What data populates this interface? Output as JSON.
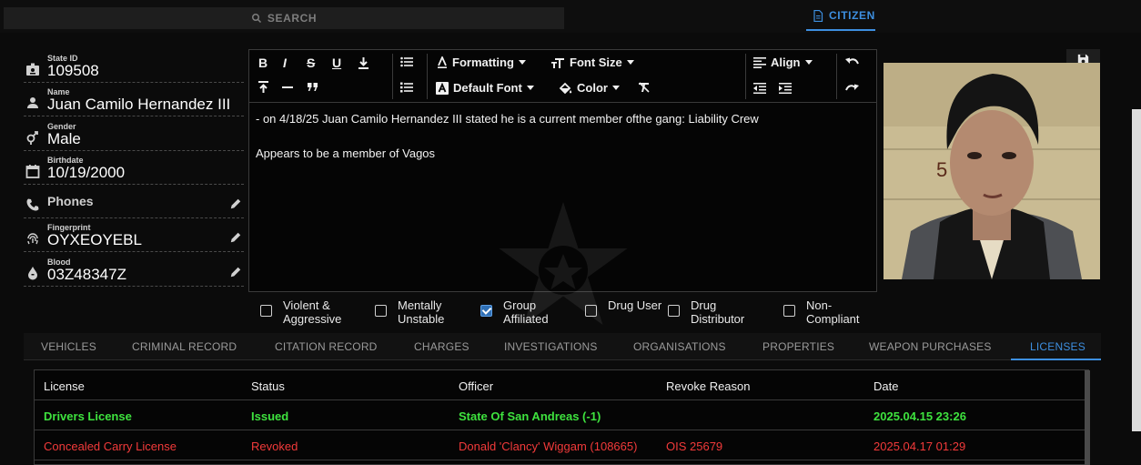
{
  "search": {
    "label": "SEARCH"
  },
  "header": {
    "citizen_tab": "CITIZEN"
  },
  "profile": {
    "state_id": {
      "label": "State ID",
      "value": "109508"
    },
    "name": {
      "label": "Name",
      "value": "Juan Camilo Hernandez III"
    },
    "gender": {
      "label": "Gender",
      "value": "Male"
    },
    "birthdate": {
      "label": "Birthdate",
      "value": "10/19/2000"
    },
    "phones": {
      "label": "Phones"
    },
    "fingerprint": {
      "label": "Fingerprint",
      "value": "OYXEOYEBL"
    },
    "blood": {
      "label": "Blood",
      "value": "03Z48347Z"
    }
  },
  "editor": {
    "toolbar": {
      "formatting": "Formatting",
      "font_size": "Font Size",
      "align": "Align",
      "default_font": "Default Font",
      "color": "Color"
    },
    "content": {
      "line1": "- on 4/18/25 Juan Camilo Hernandez III stated he is a current member ofthe gang: Liability Crew",
      "line2": "Appears to be a member of Vagos"
    }
  },
  "flags": [
    {
      "label": "Violent & Aggressive",
      "checked": false
    },
    {
      "label": "Mentally Unstable",
      "checked": false
    },
    {
      "label": "Group Affiliated",
      "checked": true
    },
    {
      "label": "Drug User",
      "checked": false
    },
    {
      "label": "Drug Distributor",
      "checked": false
    },
    {
      "label": "Non-Compliant",
      "checked": false
    }
  ],
  "record_tabs": [
    "VEHICLES",
    "CRIMINAL RECORD",
    "CITATION RECORD",
    "CHARGES",
    "INVESTIGATIONS",
    "ORGANISATIONS",
    "PROPERTIES",
    "WEAPON PURCHASES",
    "LICENSES"
  ],
  "active_tab": "LICENSES",
  "licenses": {
    "columns": [
      "License",
      "Status",
      "Officer",
      "Revoke Reason",
      "Date"
    ],
    "rows": [
      {
        "license": "Drivers License",
        "status": "Issued",
        "officer": "State Of San Andreas (-1)",
        "reason": "",
        "date": "2025.04.15 23:26",
        "color": "#3ee23e"
      },
      {
        "license": "Concealed Carry License",
        "status": "Revoked",
        "officer": "Donald 'Clancy' Wiggam (108665)",
        "reason": "OIS 25679",
        "date": "2025.04.17 01:29",
        "color": "#f23a3a"
      }
    ]
  },
  "colors": {
    "accent": "#3d8fe0",
    "issued": "#3ee23e",
    "revoked": "#f23a3a",
    "background": "#0b0b0b"
  }
}
